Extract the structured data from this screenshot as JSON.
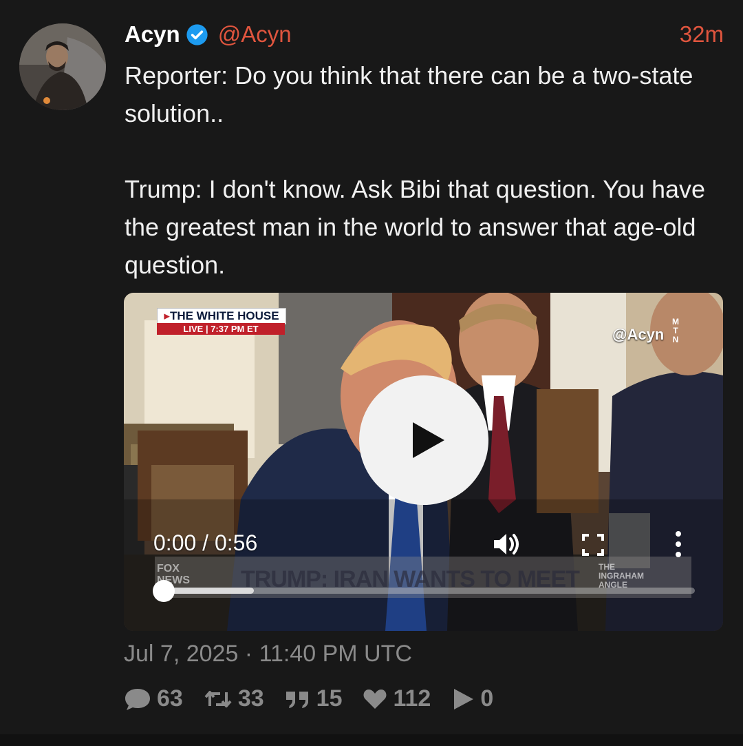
{
  "tweet": {
    "display_name": "Acyn",
    "handle": "@Acyn",
    "time_ago": "32m",
    "text": "Reporter: Do you think that there can be a two-state solution..\n\nTrump: I don't know. Ask Bibi that question. You have the greatest man in the world to answer that age-old question.",
    "date": "Jul 7, 2025 · 11:40 PM UTC"
  },
  "video": {
    "time_display": "0:00 / 0:56",
    "progress": 0.0,
    "buffered": 0.17,
    "overlay": {
      "source_line1": "THE WHITE HOUSE",
      "source_line2_live": "LIVE",
      "source_line2_time": "7:37 PM ET",
      "watermark": "@Acyn",
      "watermark_logo": "MTN",
      "chyron": "TRUMP: IRAN WANTS TO MEET",
      "network": "FOX NEWS",
      "show": "THE INGRAHAM ANGLE"
    }
  },
  "stats": {
    "replies": "63",
    "retweets": "33",
    "quotes": "15",
    "likes": "112",
    "views": "0"
  },
  "icons": {
    "verified": "verified-badge-icon",
    "play": "play-icon",
    "volume": "volume-icon",
    "fullscreen": "fullscreen-icon",
    "more": "more-vertical-icon",
    "reply": "comment-icon",
    "retweet": "retweet-icon",
    "quote": "quote-icon",
    "like": "heart-icon",
    "views": "play-count-icon"
  },
  "colors": {
    "background": "#181818",
    "accent": "#e0553e",
    "verified": "#1d9bf0",
    "text": "#f0f0f0",
    "muted": "#8a8a8a"
  }
}
